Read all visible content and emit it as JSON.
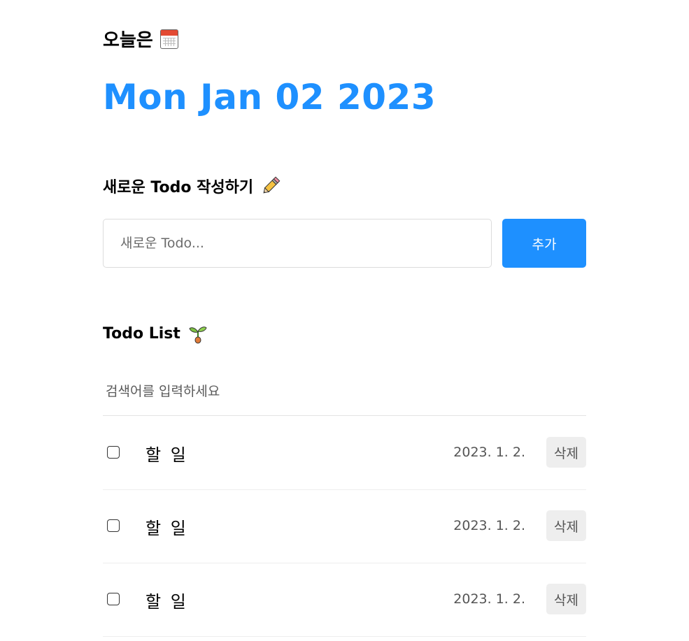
{
  "header": {
    "today_label": "오늘은",
    "today_icon": "calendar-icon",
    "date": "Mon Jan 02 2023"
  },
  "editor": {
    "title": "새로운 Todo 작성하기",
    "title_icon": "pencil-icon",
    "input_placeholder": "새로운 Todo...",
    "input_value": "",
    "add_label": "추가"
  },
  "list": {
    "title": "Todo List",
    "title_icon": "sprout-icon",
    "search_placeholder": "검색어를 입력하세요",
    "search_value": "",
    "items": [
      {
        "done": false,
        "content": "할 일",
        "date": "2023. 1. 2.",
        "delete_label": "삭제"
      },
      {
        "done": false,
        "content": "할 일",
        "date": "2023. 1. 2.",
        "delete_label": "삭제"
      },
      {
        "done": false,
        "content": "할 일",
        "date": "2023. 1. 2.",
        "delete_label": "삭제"
      }
    ]
  },
  "colors": {
    "accent": "#1e90ff",
    "delete_bg": "#eeeeee"
  }
}
